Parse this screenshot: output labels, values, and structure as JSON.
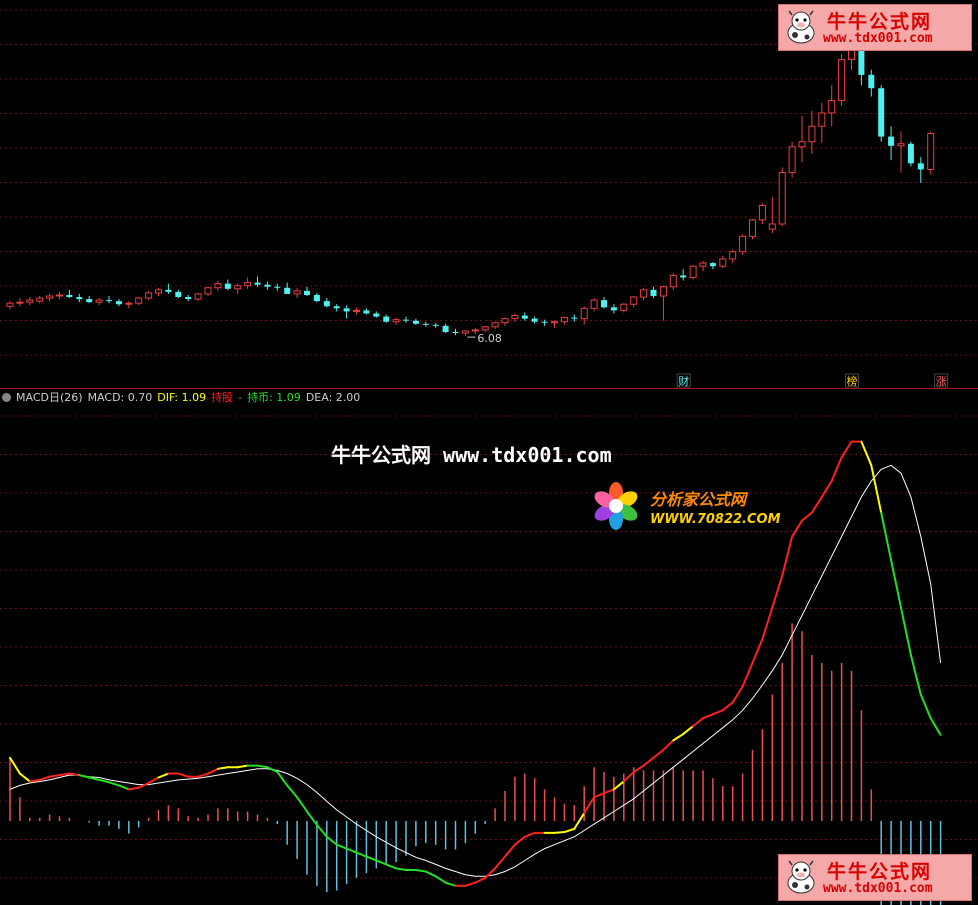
{
  "colors": {
    "up": "#e84040",
    "down": "#4ff0f0",
    "grid": "#6a1010",
    "dif_hold_stock": "#ff2020",
    "dif_hold_cash": "#20e020",
    "dif_transition": "#ffff00",
    "dea_line": "#ffffff",
    "hist_up": "#e85050",
    "hist_down": "#60c0e0"
  },
  "price_chart": {
    "low_label": "6.08",
    "badges": [
      {
        "text": "财",
        "color": "#4ff0f0"
      },
      {
        "text": "榜",
        "color": "#ffd000"
      },
      {
        "text": "涨",
        "color": "#ff6060"
      }
    ]
  },
  "macd_header": {
    "name": "MACD日(26)",
    "macd": "MACD: 0.70",
    "dif": "DIF: 1.09",
    "hold_stock": "持股",
    "dash": "-",
    "hold_cash": "持币: 1.09",
    "dea": "DEA: 2.00"
  },
  "watermarks": {
    "niuniu_title": "牛牛公式网",
    "niuniu_url": "www.tdx001.com",
    "center_cn": "牛牛公式网",
    "center_url": "www.tdx001.com",
    "fxj_title": "分析家公式网",
    "fxj_url": "WWW.70822.COM"
  },
  "chart_data": {
    "type": "candlestick+macd",
    "candles": [
      [
        12.0,
        12.5,
        11.7,
        12.3
      ],
      [
        12.3,
        12.8,
        12.0,
        12.4
      ],
      [
        12.4,
        12.9,
        12.1,
        12.6
      ],
      [
        12.5,
        13.0,
        12.3,
        12.8
      ],
      [
        12.8,
        13.2,
        12.5,
        13.0
      ],
      [
        13.0,
        13.4,
        12.7,
        13.1
      ],
      [
        13.1,
        13.6,
        12.8,
        12.9
      ],
      [
        12.9,
        13.2,
        12.4,
        12.7
      ],
      [
        12.7,
        13.0,
        12.3,
        12.4
      ],
      [
        12.4,
        12.8,
        12.1,
        12.6
      ],
      [
        12.6,
        13.0,
        12.3,
        12.5
      ],
      [
        12.5,
        12.7,
        12.0,
        12.2
      ],
      [
        12.2,
        12.5,
        11.8,
        12.3
      ],
      [
        12.3,
        12.9,
        12.1,
        12.8
      ],
      [
        12.8,
        13.5,
        12.6,
        13.3
      ],
      [
        13.3,
        13.8,
        13.0,
        13.6
      ],
      [
        13.6,
        14.2,
        13.2,
        13.4
      ],
      [
        13.4,
        13.6,
        12.8,
        12.9
      ],
      [
        12.9,
        13.1,
        12.5,
        12.7
      ],
      [
        12.7,
        13.3,
        12.5,
        13.2
      ],
      [
        13.2,
        13.9,
        13.0,
        13.8
      ],
      [
        13.8,
        14.5,
        13.5,
        14.2
      ],
      [
        14.2,
        14.6,
        13.6,
        13.7
      ],
      [
        13.7,
        14.2,
        13.2,
        14.0
      ],
      [
        14.0,
        14.8,
        13.7,
        14.3
      ],
      [
        14.3,
        14.9,
        13.9,
        14.1
      ],
      [
        14.1,
        14.4,
        13.6,
        13.9
      ],
      [
        13.9,
        14.2,
        13.5,
        13.8
      ],
      [
        13.8,
        14.3,
        13.4,
        13.2
      ],
      [
        13.2,
        13.8,
        12.8,
        13.5
      ],
      [
        13.5,
        13.9,
        13.0,
        13.1
      ],
      [
        13.1,
        13.3,
        12.4,
        12.5
      ],
      [
        12.5,
        12.8,
        11.9,
        12.0
      ],
      [
        12.0,
        12.2,
        11.5,
        11.8
      ],
      [
        11.8,
        12.1,
        10.8,
        11.5
      ],
      [
        11.5,
        11.9,
        11.2,
        11.6
      ],
      [
        11.6,
        11.8,
        11.2,
        11.3
      ],
      [
        11.3,
        11.5,
        10.9,
        11.0
      ],
      [
        11.0,
        11.2,
        10.4,
        10.5
      ],
      [
        10.5,
        10.9,
        10.2,
        10.7
      ],
      [
        10.7,
        11.0,
        10.4,
        10.6
      ],
      [
        10.6,
        10.8,
        10.2,
        10.3
      ],
      [
        10.3,
        10.5,
        10.0,
        10.2
      ],
      [
        10.2,
        10.4,
        9.9,
        10.1
      ],
      [
        10.1,
        10.3,
        9.4,
        9.5
      ],
      [
        9.5,
        9.8,
        9.2,
        9.4
      ],
      [
        9.4,
        9.7,
        9.1,
        9.6
      ],
      [
        9.6,
        9.9,
        9.3,
        9.7
      ],
      [
        9.7,
        10.1,
        9.5,
        10.0
      ],
      [
        10.0,
        10.5,
        9.8,
        10.4
      ],
      [
        10.4,
        10.9,
        10.1,
        10.8
      ],
      [
        10.8,
        11.3,
        10.5,
        11.1
      ],
      [
        11.1,
        11.4,
        10.6,
        10.8
      ],
      [
        10.8,
        11.0,
        10.3,
        10.5
      ],
      [
        10.5,
        10.7,
        10.1,
        10.4
      ],
      [
        10.4,
        10.6,
        9.9,
        10.5
      ],
      [
        10.5,
        11.0,
        10.2,
        10.9
      ],
      [
        10.9,
        11.2,
        10.5,
        10.8
      ],
      [
        10.8,
        12.0,
        10.2,
        11.8
      ],
      [
        11.8,
        12.8,
        11.5,
        12.6
      ],
      [
        12.6,
        12.9,
        11.8,
        11.9
      ],
      [
        11.9,
        12.2,
        11.3,
        11.6
      ],
      [
        11.6,
        12.3,
        11.4,
        12.2
      ],
      [
        12.2,
        13.0,
        11.9,
        12.9
      ],
      [
        12.9,
        13.8,
        12.6,
        13.6
      ],
      [
        13.6,
        13.9,
        12.8,
        13.0
      ],
      [
        13.0,
        14.0,
        10.6,
        13.9
      ],
      [
        13.9,
        15.2,
        13.6,
        15.0
      ],
      [
        15.0,
        15.6,
        14.5,
        14.8
      ],
      [
        14.8,
        16.0,
        14.6,
        15.9
      ],
      [
        15.9,
        16.4,
        15.4,
        16.2
      ],
      [
        16.2,
        16.3,
        15.6,
        15.9
      ],
      [
        15.9,
        16.9,
        15.7,
        16.6
      ],
      [
        16.6,
        17.5,
        16.2,
        17.3
      ],
      [
        17.3,
        19.0,
        17.0,
        18.8
      ],
      [
        18.8,
        20.5,
        18.5,
        20.4
      ],
      [
        20.4,
        22.0,
        20.0,
        21.8
      ],
      [
        19.5,
        22.6,
        19.1,
        20.0
      ],
      [
        20.0,
        25.5,
        19.8,
        25.0
      ],
      [
        25.0,
        28.0,
        24.5,
        27.5
      ],
      [
        27.5,
        30.5,
        26.0,
        28.0
      ],
      [
        28.0,
        31.0,
        26.8,
        29.5
      ],
      [
        29.5,
        31.8,
        27.9,
        30.8
      ],
      [
        30.8,
        33.5,
        29.5,
        32.0
      ],
      [
        32.0,
        36.5,
        31.5,
        36.0
      ],
      [
        36.0,
        38.5,
        35.0,
        37.0
      ],
      [
        37.0,
        38.8,
        33.5,
        34.5
      ],
      [
        34.5,
        35.0,
        32.4,
        33.2
      ],
      [
        33.2,
        33.5,
        28.0,
        28.5
      ],
      [
        28.5,
        29.5,
        26.2,
        27.6
      ],
      [
        27.6,
        29.0,
        25.0,
        27.8
      ],
      [
        27.8,
        28.0,
        25.6,
        25.9
      ],
      [
        25.9,
        26.5,
        24.0,
        25.3
      ],
      [
        25.3,
        29.0,
        24.8,
        28.8
      ]
    ],
    "price_range": [
      6.0,
      41.0
    ],
    "dif": [
      0.8,
      0.6,
      0.5,
      0.52,
      0.56,
      0.58,
      0.6,
      0.58,
      0.55,
      0.52,
      0.49,
      0.45,
      0.4,
      0.42,
      0.48,
      0.55,
      0.6,
      0.6,
      0.56,
      0.56,
      0.6,
      0.66,
      0.68,
      0.68,
      0.7,
      0.7,
      0.68,
      0.62,
      0.45,
      0.3,
      0.12,
      -0.05,
      -0.2,
      -0.3,
      -0.35,
      -0.4,
      -0.45,
      -0.5,
      -0.55,
      -0.6,
      -0.62,
      -0.62,
      -0.64,
      -0.7,
      -0.78,
      -0.82,
      -0.82,
      -0.78,
      -0.72,
      -0.6,
      -0.45,
      -0.3,
      -0.2,
      -0.15,
      -0.15,
      -0.15,
      -0.14,
      -0.1,
      0.1,
      0.3,
      0.35,
      0.4,
      0.5,
      0.62,
      0.7,
      0.8,
      0.9,
      1.02,
      1.1,
      1.2,
      1.3,
      1.35,
      1.4,
      1.5,
      1.7,
      2.0,
      2.3,
      2.7,
      3.1,
      3.6,
      3.8,
      3.9,
      4.1,
      4.3,
      4.6,
      4.8,
      4.8,
      4.5,
      3.9,
      3.3,
      2.7,
      2.1,
      1.6,
      1.3,
      1.09
    ],
    "dea": [
      0.4,
      0.45,
      0.48,
      0.5,
      0.52,
      0.55,
      0.58,
      0.58,
      0.56,
      0.55,
      0.52,
      0.5,
      0.48,
      0.46,
      0.46,
      0.48,
      0.5,
      0.52,
      0.53,
      0.54,
      0.56,
      0.58,
      0.6,
      0.62,
      0.64,
      0.66,
      0.66,
      0.64,
      0.6,
      0.54,
      0.46,
      0.36,
      0.25,
      0.14,
      0.05,
      -0.04,
      -0.12,
      -0.2,
      -0.27,
      -0.34,
      -0.4,
      -0.46,
      -0.5,
      -0.55,
      -0.6,
      -0.64,
      -0.68,
      -0.7,
      -0.7,
      -0.68,
      -0.64,
      -0.58,
      -0.5,
      -0.42,
      -0.35,
      -0.3,
      -0.25,
      -0.2,
      -0.12,
      -0.04,
      0.04,
      0.12,
      0.2,
      0.28,
      0.38,
      0.48,
      0.58,
      0.68,
      0.78,
      0.88,
      0.98,
      1.08,
      1.18,
      1.28,
      1.4,
      1.55,
      1.72,
      1.9,
      2.1,
      2.35,
      2.6,
      2.85,
      3.1,
      3.35,
      3.6,
      3.85,
      4.1,
      4.3,
      4.45,
      4.5,
      4.4,
      4.1,
      3.6,
      3.0,
      2.0
    ],
    "dif_state": "ryyrrrrrgggggrrryrrrrryyygggggggggggggggggggggrrrrrrrrryyyyrrryrrrrryyrrrrrrrrrrrrrrrrryygggggggg",
    "macd_range": [
      -1.0,
      5.2
    ]
  }
}
